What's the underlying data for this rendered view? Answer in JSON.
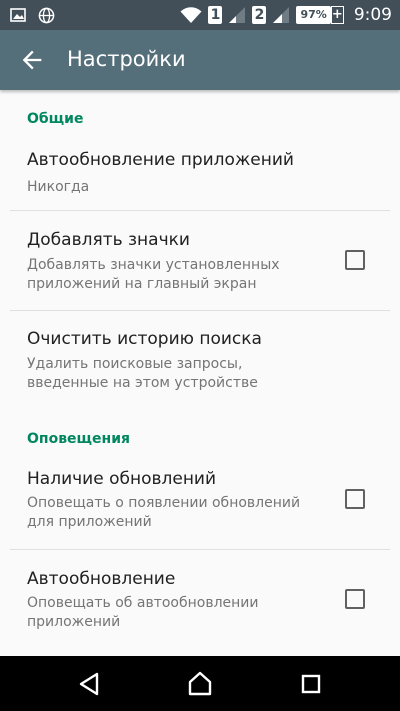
{
  "status_bar": {
    "sim1": "1",
    "sim2": "2",
    "battery": "97%",
    "time": "9:09",
    "icons": [
      "image-icon",
      "globe-icon",
      "wifi-icon",
      "signal-icon",
      "battery-plus-icon"
    ]
  },
  "app_bar": {
    "title": "Настройки",
    "back_icon": "arrow-back-icon"
  },
  "sections": [
    {
      "header": "Общие",
      "items": [
        {
          "title": "Автообновление приложений",
          "subtitle": "Никогда",
          "checkbox": false
        },
        {
          "title": "Добавлять значки",
          "subtitle": "Добавлять значки установленных приложений на главный экран",
          "checkbox": true,
          "checked": false
        },
        {
          "title": "Очистить историю поиска",
          "subtitle": "Удалить поисковые запросы, введенные на этом устройстве",
          "checkbox": false
        }
      ]
    },
    {
      "header": "Оповещения",
      "items": [
        {
          "title": "Наличие обновлений",
          "subtitle": "Оповещать о появлении обновлений для приложений",
          "checkbox": true,
          "checked": false
        },
        {
          "title": "Автообновление",
          "subtitle": "Оповещать об автообновлении приложений",
          "checkbox": true,
          "checked": false
        }
      ]
    }
  ],
  "nav_bar": {
    "icons": [
      "back-triangle-icon",
      "home-icon",
      "recents-icon"
    ]
  },
  "colors": {
    "status_bar": "#424f58",
    "app_bar": "#546e7a",
    "section_header": "#01875f",
    "background": "#fafafa"
  }
}
